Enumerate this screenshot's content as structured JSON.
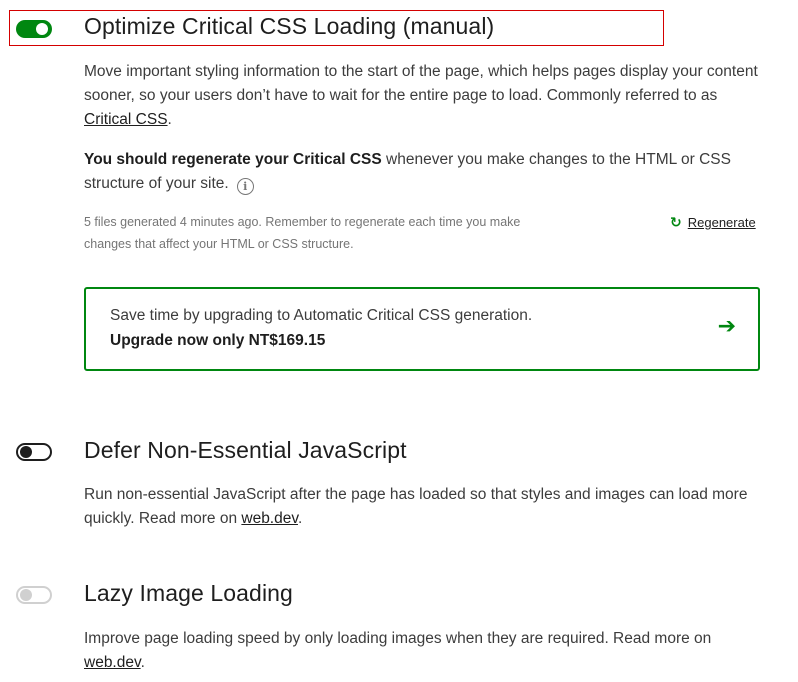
{
  "critical_css": {
    "toggle_state": "on",
    "title": "Optimize Critical CSS Loading (manual)",
    "description_1": "Move important styling information to the start of the page, which helps pages display your content sooner, so your users don’t have to wait for the entire page to load. Commonly referred to as ",
    "description_link": "Critical CSS",
    "description_end": ".",
    "regenerate_bold": "You should regenerate your Critical CSS",
    "regenerate_rest": " whenever you make changes to the HTML or CSS structure of your site.",
    "info_icon": "i",
    "status_text": "5 files generated 4 minutes ago. Remember to regenerate each time you make changes that affect your HTML or CSS structure.",
    "regenerate_icon": "↻",
    "regenerate_label": "Regenerate",
    "upgrade_line1": "Save time by upgrading to Automatic Critical CSS generation.",
    "upgrade_line2": "Upgrade now only NT$169.15",
    "upgrade_arrow": "➔"
  },
  "defer_js": {
    "toggle_state": "off",
    "title": "Defer Non-Essential JavaScript",
    "description": "Run non-essential JavaScript after the page has loaded so that styles and images can load more quickly. Read more on ",
    "link": "web.dev",
    "end": "."
  },
  "lazy_images": {
    "toggle_state": "disabled",
    "title": "Lazy Image Loading",
    "description": "Improve page loading speed by only loading images when they are required. Read more on ",
    "link": "web.dev",
    "end": "."
  },
  "colors": {
    "accent": "#008710",
    "highlight": "#d40000"
  }
}
